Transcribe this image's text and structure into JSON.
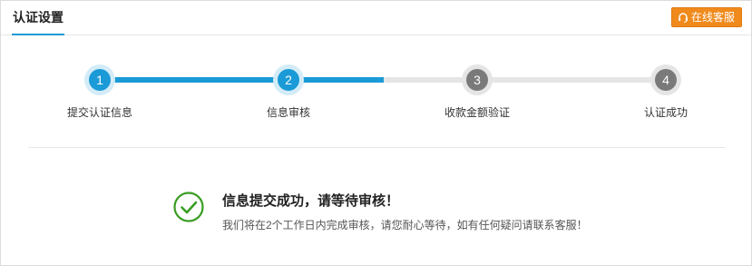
{
  "header": {
    "tab_title": "认证设置",
    "service_button": {
      "label": "在线客服",
      "icon": "headset-icon"
    }
  },
  "steps": [
    {
      "number": "1",
      "label": "提交认证信息",
      "state": "active"
    },
    {
      "number": "2",
      "label": "信息审核",
      "state": "active"
    },
    {
      "number": "3",
      "label": "收款金额验证",
      "state": "inactive"
    },
    {
      "number": "4",
      "label": "认证成功",
      "state": "inactive"
    }
  ],
  "progress": 0.5,
  "result": {
    "icon": "check-circle-icon",
    "title": "信息提交成功，请等待审核！",
    "description": "我们将在2个工作日内完成审核，请您耐心等待，如有任何疑问请联系客服！"
  },
  "colors": {
    "accent": "#1a9ad6",
    "service_button": "#f08a1c",
    "success": "#3a9d23",
    "inactive_step": "#7a7a7a"
  }
}
